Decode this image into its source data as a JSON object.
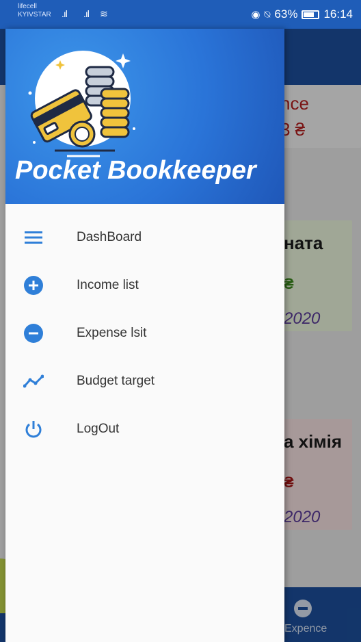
{
  "status_bar": {
    "carrier1": "lifecell",
    "carrier2": "KYIVSTAR",
    "battery": "63%",
    "time": "16:14"
  },
  "background": {
    "balance_label": "nce",
    "balance_value": "3 ₴",
    "income_card": {
      "title": "ната",
      "amount": "₴",
      "date": "2020"
    },
    "expense_card": {
      "title": "а хімія",
      "amount": "₴",
      "date": "2020"
    },
    "bottom_nav_label": "Expence"
  },
  "drawer": {
    "app_title": "Pocket Bookkeeper",
    "menu": [
      {
        "label": "DashBoard",
        "icon": "menu-icon"
      },
      {
        "label": "Income list",
        "icon": "plus-circle-icon"
      },
      {
        "label": "Expense lsit",
        "icon": "minus-circle-icon"
      },
      {
        "label": "Budget target",
        "icon": "trend-icon"
      },
      {
        "label": "LogOut",
        "icon": "power-icon"
      }
    ]
  },
  "colors": {
    "drawer_header": "#2a74d8",
    "icon_blue": "#2f7fd8",
    "app_bar": "#1c4f9c"
  }
}
